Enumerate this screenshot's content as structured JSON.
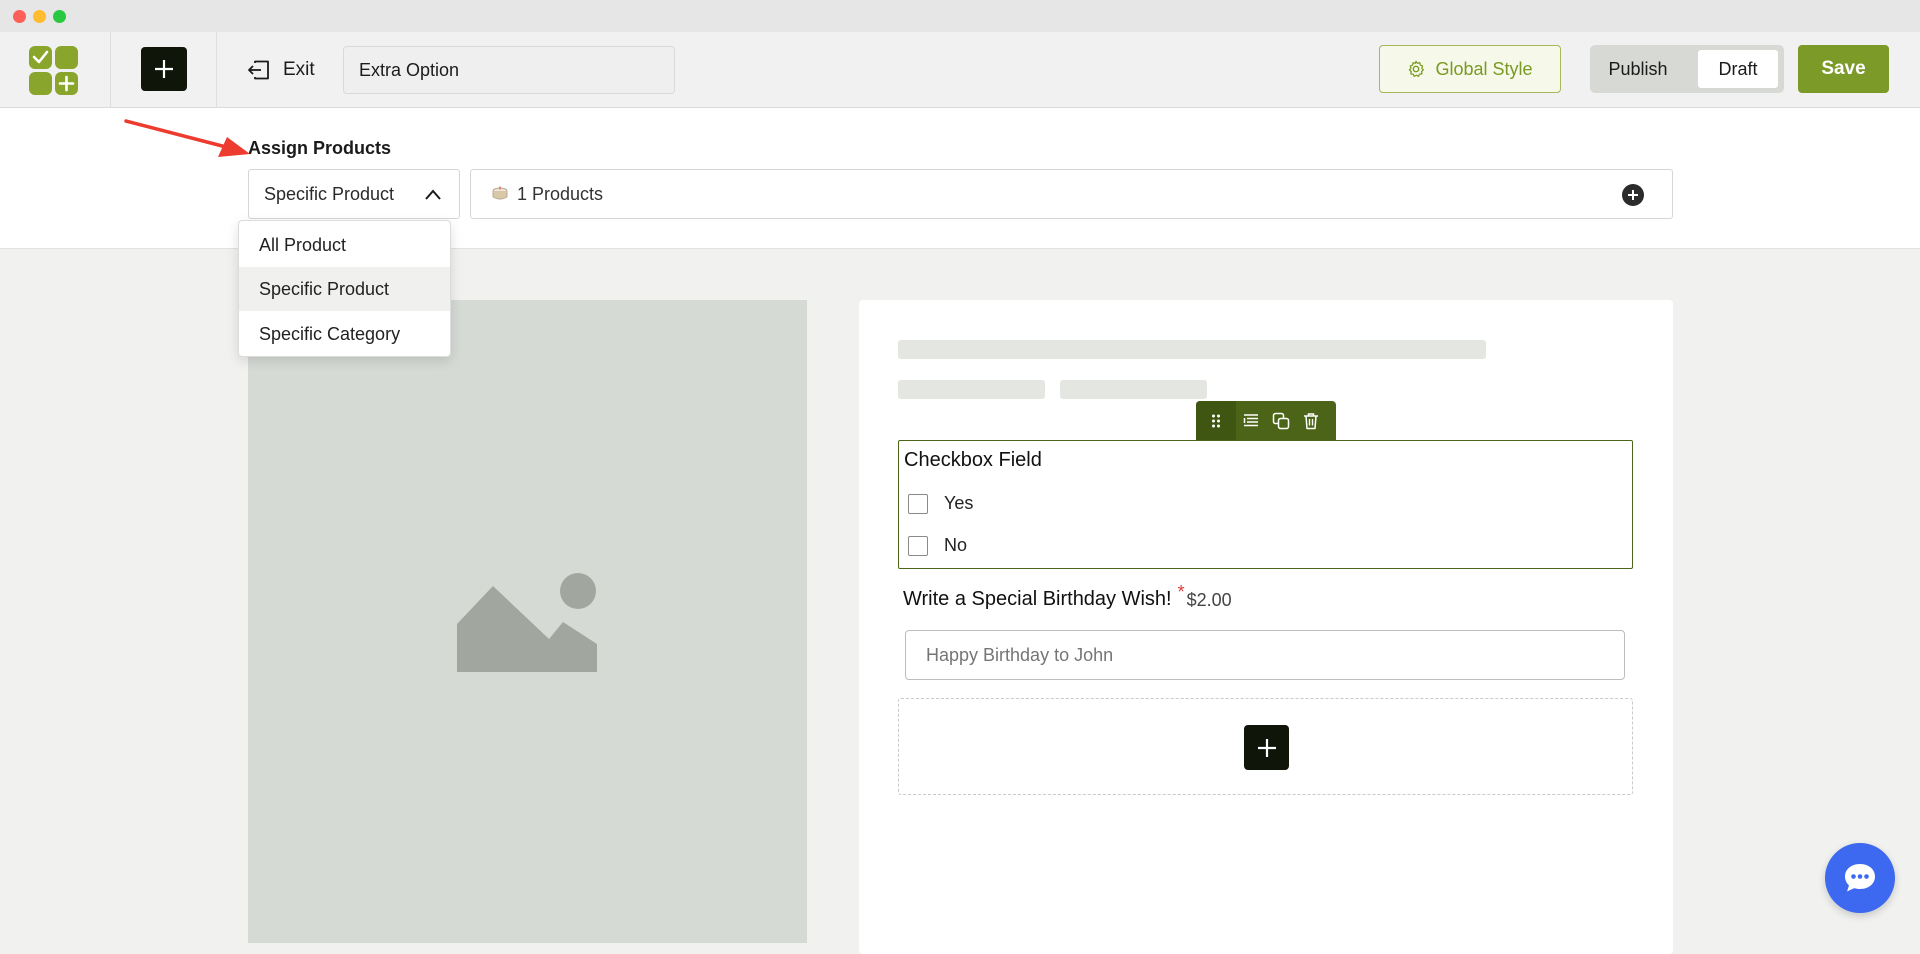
{
  "window": {
    "controls": [
      "close",
      "minimize",
      "maximize"
    ]
  },
  "toolbar": {
    "logo_icon": "checklist-logo-icon",
    "add_icon": "plus-icon",
    "exit_label": "Exit",
    "exit_icon": "exit-icon",
    "option_title_value": "Extra Option",
    "global_style_label": "Global Style",
    "global_style_icon": "gear-icon",
    "publish_label": "Publish",
    "draft_label": "Draft",
    "publish_state": "Draft",
    "save_label": "Save",
    "accent_color": "#7b9a28"
  },
  "assign": {
    "label": "Assign Products",
    "selected": "Specific Product",
    "products_summary": "1 Products",
    "products_icon": "cake-icon",
    "add_icon": "plus-circle-icon"
  },
  "dropdown": {
    "options": [
      "All Product",
      "Specific Product",
      "Specific Category"
    ],
    "active_index": 1
  },
  "form": {
    "field_toolbar_icons": [
      "drag-handle-icon",
      "settings-list-icon",
      "duplicate-icon",
      "trash-icon"
    ],
    "checkbox_field": {
      "title": "Checkbox Field",
      "options": [
        "Yes",
        "No"
      ]
    },
    "wish_field": {
      "label": "Write a Special Birthday Wish!",
      "required_mark": "*",
      "price": "$2.00",
      "placeholder": "Happy Birthday to John"
    },
    "add_field_icon": "plus-icon"
  },
  "chat": {
    "icon": "chat-bubble-icon",
    "color": "#3d68f0"
  }
}
